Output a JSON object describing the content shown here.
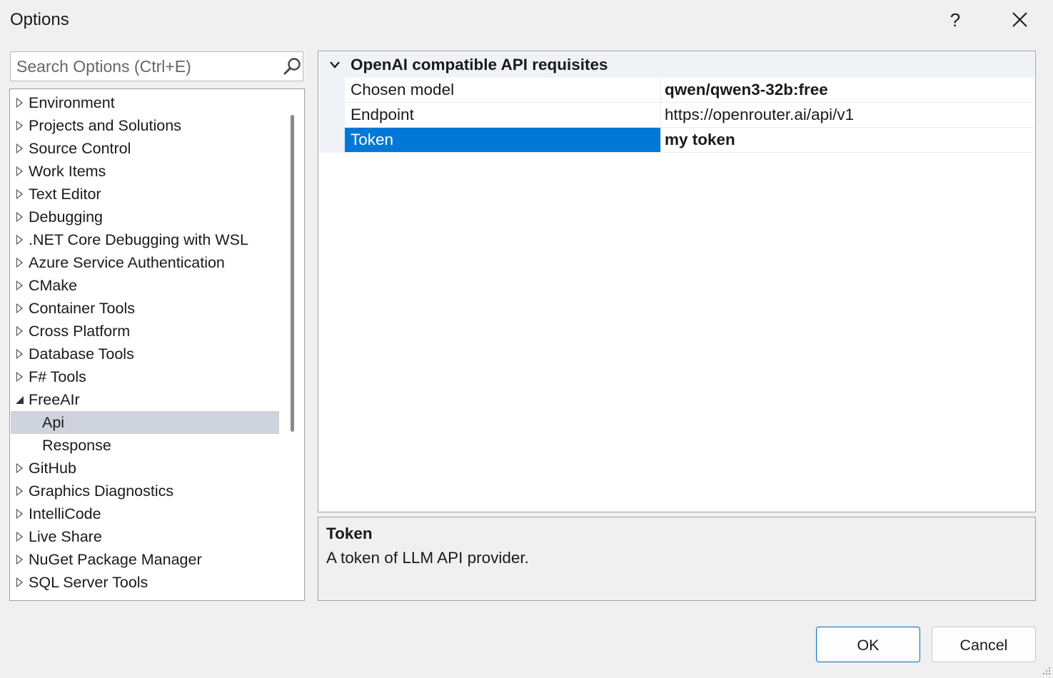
{
  "window": {
    "title": "Options",
    "help_label": "?",
    "close_icon": "close-icon"
  },
  "search": {
    "placeholder": "Search Options (Ctrl+E)",
    "icon": "search-icon"
  },
  "tree": {
    "items": [
      {
        "label": "Environment",
        "state": "collapsed",
        "level": 0
      },
      {
        "label": "Projects and Solutions",
        "state": "collapsed",
        "level": 0
      },
      {
        "label": "Source Control",
        "state": "collapsed",
        "level": 0
      },
      {
        "label": "Work Items",
        "state": "collapsed",
        "level": 0
      },
      {
        "label": "Text Editor",
        "state": "collapsed",
        "level": 0
      },
      {
        "label": "Debugging",
        "state": "collapsed",
        "level": 0
      },
      {
        "label": ".NET Core Debugging with WSL",
        "state": "collapsed",
        "level": 0
      },
      {
        "label": "Azure Service Authentication",
        "state": "collapsed",
        "level": 0
      },
      {
        "label": "CMake",
        "state": "collapsed",
        "level": 0
      },
      {
        "label": "Container Tools",
        "state": "collapsed",
        "level": 0
      },
      {
        "label": "Cross Platform",
        "state": "collapsed",
        "level": 0
      },
      {
        "label": "Database Tools",
        "state": "collapsed",
        "level": 0
      },
      {
        "label": "F# Tools",
        "state": "collapsed",
        "level": 0
      },
      {
        "label": "FreeAIr",
        "state": "expanded",
        "level": 0
      },
      {
        "label": "Api",
        "state": "leaf",
        "level": 1,
        "selected": true
      },
      {
        "label": "Response",
        "state": "leaf",
        "level": 1
      },
      {
        "label": "GitHub",
        "state": "collapsed",
        "level": 0
      },
      {
        "label": "Graphics Diagnostics",
        "state": "collapsed",
        "level": 0
      },
      {
        "label": "IntelliCode",
        "state": "collapsed",
        "level": 0
      },
      {
        "label": "Live Share",
        "state": "collapsed",
        "level": 0
      },
      {
        "label": "NuGet Package Manager",
        "state": "collapsed",
        "level": 0
      },
      {
        "label": "SQL Server Tools",
        "state": "collapsed",
        "level": 0
      }
    ]
  },
  "property_grid": {
    "category": "OpenAI compatible API requisites",
    "properties": [
      {
        "name": "Chosen model",
        "value": "qwen/qwen3-32b:free",
        "bold": true
      },
      {
        "name": "Endpoint",
        "value": "https://openrouter.ai/api/v1",
        "bold": false
      },
      {
        "name": "Token",
        "value": "my token",
        "bold": true,
        "selected": true
      }
    ]
  },
  "description": {
    "title": "Token",
    "text": "A token of LLM API provider."
  },
  "buttons": {
    "ok": "OK",
    "cancel": "Cancel"
  },
  "colors": {
    "selection_blue": "#0078d7",
    "tree_selection": "#cfd3de",
    "ok_border": "#0067c0"
  }
}
